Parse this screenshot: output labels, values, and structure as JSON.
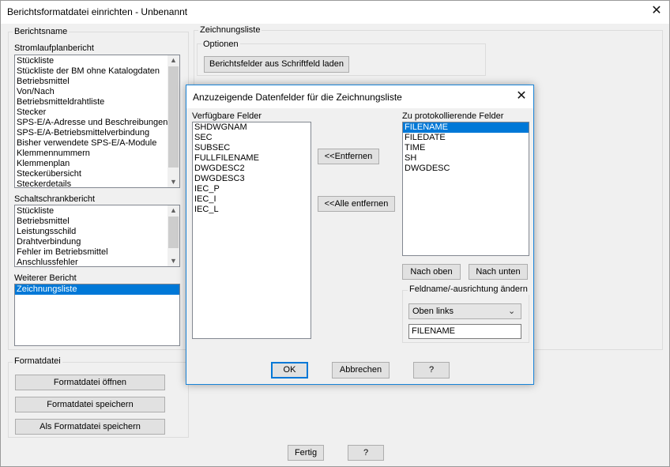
{
  "window": {
    "title": "Berichtsformatdatei einrichten - Unbenannt",
    "close_glyph": "✕"
  },
  "berichtsname": {
    "group_label": "Berichtsname",
    "stromlauf": {
      "label": "Stromlaufplanbericht",
      "items": [
        "Stückliste",
        "Stückliste der BM ohne Katalogdaten",
        "Betriebsmittel",
        "Von/Nach",
        "Betriebsmitteldrahtliste",
        "Stecker",
        "SPS-E/A-Adresse und Beschreibungen",
        "SPS-E/A-Betriebsmittelverbindung",
        "Bisher verwendete SPS-E/A-Module",
        "Klemmennummern",
        "Klemmenplan",
        "Steckerübersicht",
        "Steckerdetails"
      ]
    },
    "schaltschrank": {
      "label": "Schaltschrankbericht",
      "items": [
        "Stückliste",
        "Betriebsmittel",
        "Leistungsschild",
        "Drahtverbindung",
        "Fehler im Betriebsmittel",
        "Anschlussfehler"
      ]
    },
    "weiterer": {
      "label": "Weiterer Bericht",
      "items": [
        "Zeichnungsliste"
      ]
    }
  },
  "formatdatei": {
    "group_label": "Formatdatei",
    "open_button": "Formatdatei öffnen",
    "save_button": "Formatdatei speichern",
    "save_as_button": "Als Formatdatei speichern"
  },
  "zeichnungsliste": {
    "group_label": "Zeichnungsliste",
    "optionen_label": "Optionen",
    "load_button": "Berichtsfelder aus Schriftfeld laden"
  },
  "footer": {
    "done_button": "Fertig",
    "help_button": "?"
  },
  "dialog": {
    "title": "Anzuzeigende Datenfelder für die Zeichnungsliste",
    "available_label": "Verfügbare Felder",
    "available_items": [
      "SHDWGNAM",
      "SEC",
      "SUBSEC",
      "FULLFILENAME",
      "DWGDESC2",
      "DWGDESC3",
      "IEC_P",
      "IEC_I",
      "IEC_L"
    ],
    "remove_button": "<<Entfernen",
    "remove_all_button": "<<Alle entfernen",
    "logged_label": "Zu protokollierende Felder",
    "logged_items": [
      "FILENAME",
      "FILEDATE",
      "TIME",
      "SH",
      "DWGDESC"
    ],
    "move_up_button": "Nach oben",
    "move_down_button": "Nach unten",
    "field_group_label": "Feldname/-ausrichtung ändern",
    "alignment_value": "Oben links",
    "fieldname_value": "FILENAME",
    "ok_button": "OK",
    "cancel_button": "Abbrechen",
    "help_button": "?",
    "close_glyph": "✕"
  }
}
